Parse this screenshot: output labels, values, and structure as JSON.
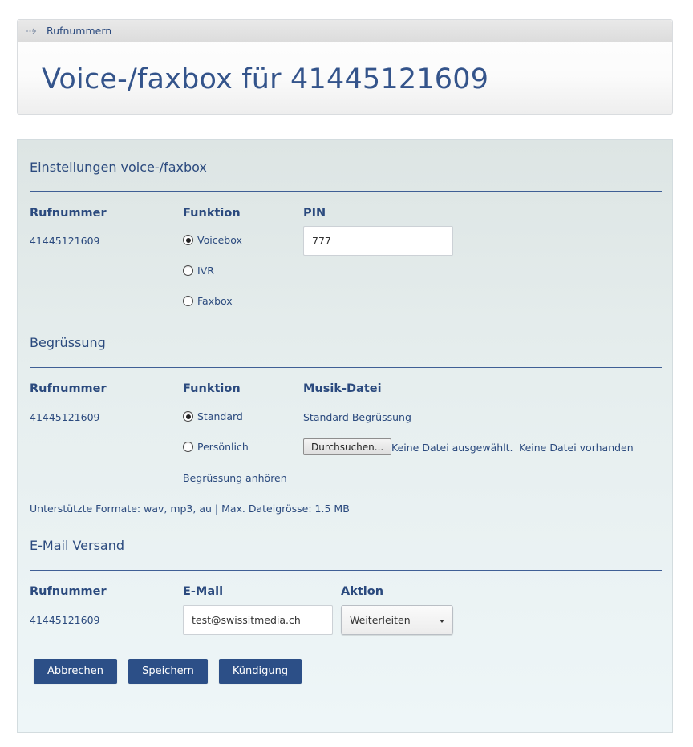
{
  "breadcrumb": {
    "label": "Rufnummern"
  },
  "page_title": "Voice-/faxbox für 41445121609",
  "settings": {
    "title": "Einstellungen voice-/faxbox",
    "col_number": "Rufnummer",
    "col_function": "Funktion",
    "col_pin": "PIN",
    "number": "41445121609",
    "options": [
      {
        "label": "Voicebox",
        "selected": true
      },
      {
        "label": "IVR",
        "selected": false
      },
      {
        "label": "Faxbox",
        "selected": false
      }
    ],
    "pin_value": "777"
  },
  "greeting": {
    "title": "Begrüssung",
    "col_number": "Rufnummer",
    "col_function": "Funktion",
    "col_file": "Musik-Datei",
    "number": "41445121609",
    "options": [
      {
        "label": "Standard",
        "selected": true
      },
      {
        "label": "Persönlich",
        "selected": false
      }
    ],
    "standard_file": "Standard Begrüssung",
    "browse_label": "Durchsuchen...",
    "no_file_selected": "Keine Datei ausgewählt.",
    "no_file_present": "Keine Datei vorhanden",
    "listen_link": "Begrüssung anhören",
    "formats_note": "Unterstützte Formate: wav, mp3, au | Max. Dateigrösse: 1.5 MB"
  },
  "email": {
    "title": "E-Mail Versand",
    "col_number": "Rufnummer",
    "col_email": "E-Mail",
    "col_action": "Aktion",
    "number": "41445121609",
    "email_value": "test@swissitmedia.ch",
    "action_selected": "Weiterleiten"
  },
  "buttons": {
    "cancel": "Abbrechen",
    "save": "Speichern",
    "terminate": "Kündigung"
  },
  "colors": {
    "accent": "#2c4f87",
    "text": "#2b4a7e",
    "panel_bg": "#e6eeee"
  }
}
